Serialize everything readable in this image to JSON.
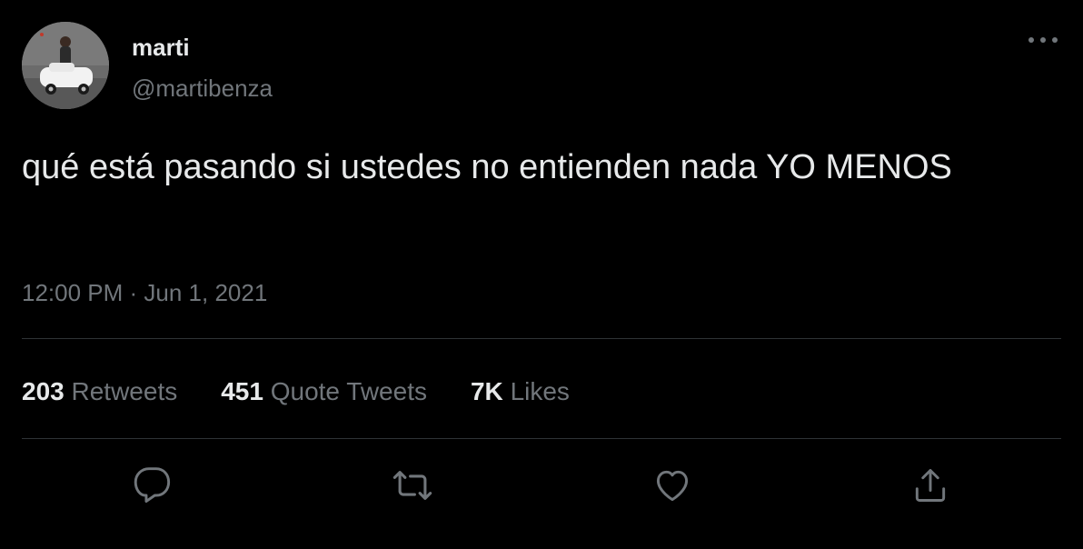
{
  "tweet": {
    "author": {
      "display_name": "marti",
      "handle": "@martibenza"
    },
    "text": "qué está pasando si ustedes no entienden nada YO MENOS",
    "timestamp": "12:00 PM · Jun 1, 2021",
    "stats": {
      "retweets": {
        "count": "203",
        "label": "Retweets"
      },
      "quote_tweets": {
        "count": "451",
        "label": "Quote Tweets"
      },
      "likes": {
        "count": "7K",
        "label": "Likes"
      }
    }
  },
  "icons": {
    "more": "more-horizontal-icon",
    "reply": "reply-icon",
    "retweet": "retweet-icon",
    "like": "heart-icon",
    "share": "share-icon"
  },
  "colors": {
    "background": "#000000",
    "primary_text": "#e7e9ea",
    "secondary_text": "#71767b",
    "divider": "#2f3336"
  }
}
